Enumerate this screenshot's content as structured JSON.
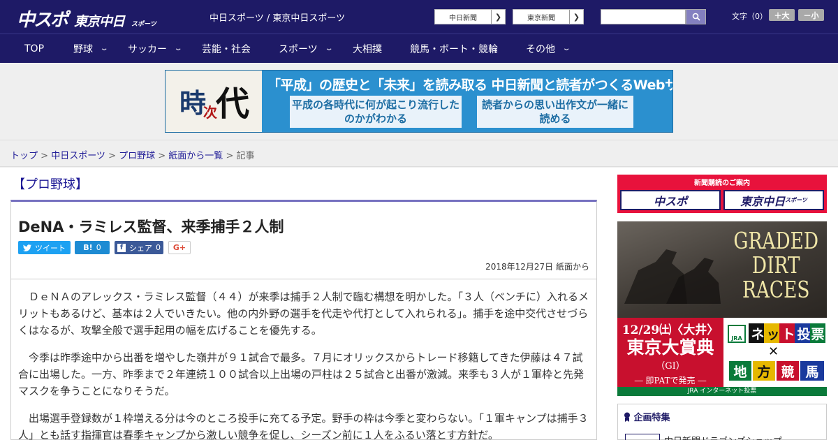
{
  "header": {
    "logo_main": "中スポ",
    "logo_tokyo": "東京中日",
    "logo_tokyo_small": "スポーツ",
    "site_links": "中日スポーツ / 東京中日スポーツ",
    "paper_buttons": [
      "中日新聞",
      "東京新聞"
    ],
    "font_label": "文字（0）",
    "font_larger": "＋大",
    "font_smaller": "－小"
  },
  "nav": [
    "TOP",
    "野球",
    "サッカー",
    "芸能・社会",
    "スポーツ",
    "大相撲",
    "競馬・ボート・競輪",
    "その他"
  ],
  "banner": {
    "kanji_1": "時",
    "kanji_2": "次",
    "kanji_3": "代",
    "headline": "「平成」の歴史と「未来」を読み取る 中日新聞と読者がつくるWebサイト",
    "sub_1": "平成の各時代に何が起こり流行したのかがわかる",
    "sub_2": "読者からの思い出作文が一緒に読める"
  },
  "breadcrumb": [
    "トップ",
    "中日スポーツ",
    "プロ野球",
    "紙面から一覧",
    "記事"
  ],
  "article": {
    "category": "【プロ野球】",
    "title": "DeNA・ラミレス監督、来季捕手２人制",
    "share": {
      "tweet": "ツイート",
      "hatena": "B!",
      "hatena_count": "0",
      "facebook": "シェア",
      "facebook_count": "0",
      "gplus": "G+"
    },
    "date": "2018年12月27日 紙面から",
    "paragraphs": [
      "ＤｅＮＡのアレックス・ラミレス監督（４４）が来季は捕手２人制で臨む構想を明かした。「３人（ベンチに）入れるメリットもあるけど、基本は２人でいきたい。他の内外野の選手を代走や代打として入れられる」。捕手を途中交代させづらくはなるが、攻撃全般で選手起用の幅を広げることを優先する。",
      "今季は昨季途中から出番を増やした嶺井が９１試合で最多。７月にオリックスからトレード移籍してきた伊藤は４７試合に出場した。一方、昨季まで２年連続１００試合以上出場の戸柱は２５試合と出番が激減。来季も３人が１軍枠と先発マスクを争うことになりそうだ。",
      "出場選手登録数が１枠増える分は今のところ投手に充てる予定。野手の枠は今季と変わらない。「１軍キャンプは捕手３人」とも話す指揮官は春季キャンプから激しい競争を促し、シーズン前に１人をふるい落とす方針だ。"
    ]
  },
  "sidebar": {
    "subscribe_header": "新聞購読のご案内",
    "subscribe_chuspo": "中スポ",
    "subscribe_tokyo": "東京中日",
    "subscribe_tokyo_small": "スポーツ",
    "race_title": [
      "GRADED",
      "DIRT",
      "RACES"
    ],
    "race_date": "12/29㈯〈大井〉",
    "race_name": "東京大賞典",
    "race_grade": "（GI）",
    "race_pat": "― 即PATで発売 ―",
    "jra_label": "JRA",
    "net_tiles": [
      "ネ",
      "ッ",
      "ト",
      "投",
      "票"
    ],
    "chiho_tiles": [
      "地",
      "方",
      "競",
      "馬"
    ],
    "race_footer": "JRA インターネット投票",
    "feature_header": "企画特集",
    "feature_item": "中日新聞ドラゴンズショップ"
  },
  "colors": {
    "brand": "#1e1a66",
    "accent": "#7671c0",
    "red": "#c8102e",
    "link": "#1e1a96"
  }
}
